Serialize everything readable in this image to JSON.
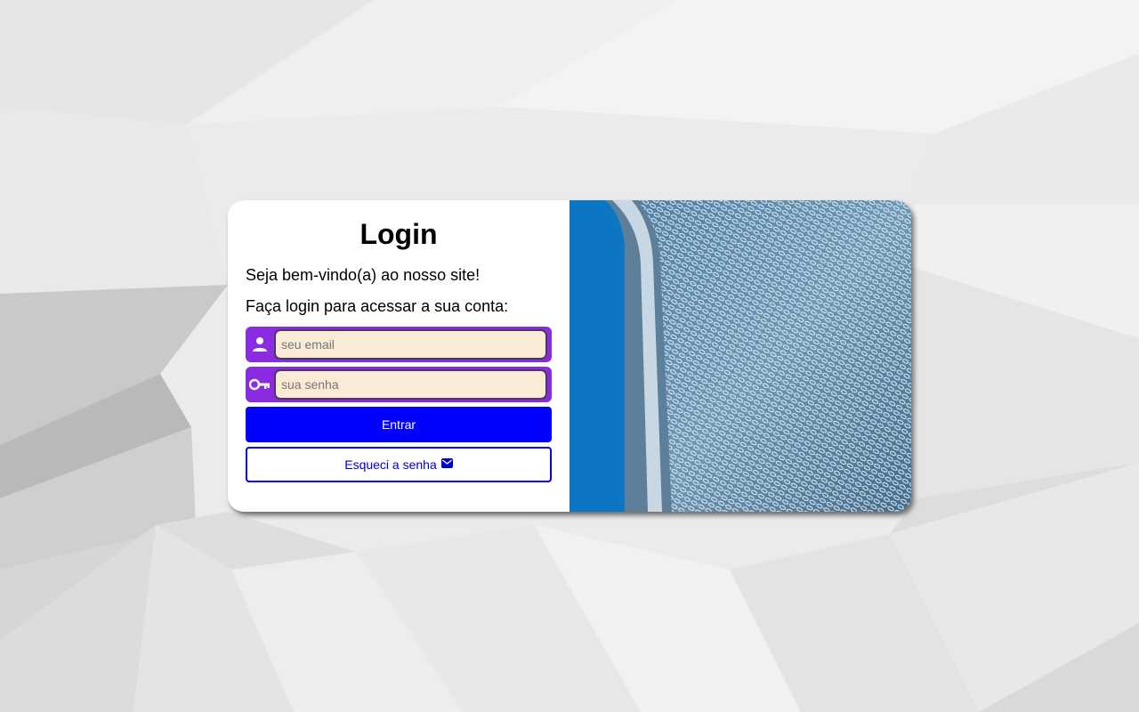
{
  "login": {
    "title": "Login",
    "welcome": "Seja bem-vindo(a) ao nosso site!",
    "instruction": "Faça login para acessar a sua conta:",
    "email": {
      "placeholder": "seu email",
      "value": "",
      "icon": "user-icon"
    },
    "password": {
      "placeholder": "sua senha",
      "value": "",
      "icon": "key-icon"
    },
    "submit_label": "Entrar",
    "forgot_label": "Esqueci a senha",
    "forgot_icon": "envelope-icon"
  },
  "image": {
    "subject": "building-facade"
  },
  "colors": {
    "field_bg": "#8a2be2",
    "input_bg": "#faebd7",
    "primary": "#0000ff",
    "secondary_border": "#0000cc"
  }
}
